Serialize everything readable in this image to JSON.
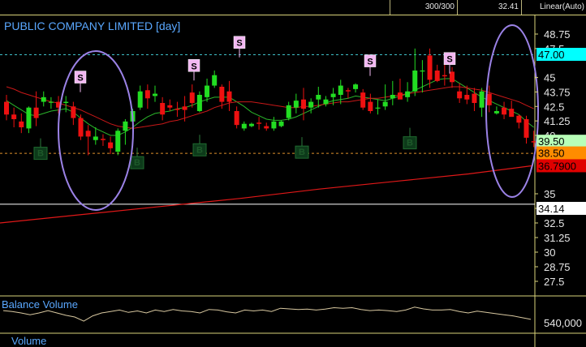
{
  "header": {
    "bars_label": "300/300",
    "last_value": "32.41",
    "scale_mode": "Linear(Auto)"
  },
  "chart_data": [
    {
      "type": "candlestick",
      "title": "PUBLIC COMPANY LIMITED [day]",
      "ylim": [
        26.8,
        50.0
      ],
      "y_ticks": [
        {
          "value": 48.75,
          "label": "48.75"
        },
        {
          "value": 47.5,
          "label": "47.5"
        },
        {
          "value": 45,
          "label": "45"
        },
        {
          "value": 43.75,
          "label": "43.75"
        },
        {
          "value": 42.5,
          "label": "42.5"
        },
        {
          "value": 41.25,
          "label": "41.25"
        },
        {
          "value": 40,
          "label": "40"
        },
        {
          "value": 35,
          "label": "35"
        },
        {
          "value": 33.75,
          "label": "33.75"
        },
        {
          "value": 32.5,
          "label": "32.5"
        },
        {
          "value": 31.25,
          "label": "31.25"
        },
        {
          "value": 30,
          "label": "30"
        },
        {
          "value": 28.75,
          "label": "28.75"
        },
        {
          "value": 27.5,
          "label": "27.5"
        }
      ],
      "price_tags": [
        {
          "label": "47.00",
          "value": 47.0,
          "bg": "#00ffff",
          "fg": "#000000"
        },
        {
          "label": "39.50",
          "value": 39.5,
          "bg": "#b8ffb8",
          "fg": "#000000"
        },
        {
          "label": "38.50",
          "value": 38.5,
          "bg": "#ff8c00",
          "fg": "#000000"
        },
        {
          "label": "36.7900",
          "value": 37.4,
          "bg": "#e00000",
          "fg": "#000000"
        },
        {
          "label": "34.14",
          "value": 33.75,
          "bg": "#ffffff",
          "fg": "#000000"
        }
      ],
      "h_lines": [
        {
          "value": 47.0,
          "style": "dashed",
          "color": "#3fc0c8"
        },
        {
          "value": 38.5,
          "style": "dashed",
          "color": "#e0902a"
        },
        {
          "value": 34.14,
          "style": "solid",
          "color": "#ffffff"
        }
      ],
      "candles": [
        [
          42.9,
          43.5,
          41.3,
          41.8
        ],
        [
          41.8,
          42.4,
          40.7,
          41.4
        ],
        [
          41.2,
          41.9,
          40.2,
          40.7
        ],
        [
          40.6,
          42.5,
          40.2,
          42.4
        ],
        [
          42.4,
          43.8,
          40.8,
          41.5
        ],
        [
          42.9,
          43.8,
          42.5,
          43.3
        ],
        [
          42.9,
          43.3,
          42.3,
          42.9
        ],
        [
          42.9,
          43.4,
          41.9,
          42.4
        ],
        [
          42.8,
          43.4,
          42.0,
          42.9
        ],
        [
          42.5,
          42.9,
          40.9,
          41.5
        ],
        [
          41.5,
          41.8,
          39.6,
          39.9
        ],
        [
          40.4,
          40.9,
          38.3,
          39.9
        ],
        [
          39.6,
          40.7,
          39.2,
          39.9
        ],
        [
          39.7,
          40.1,
          39.1,
          39.6
        ],
        [
          39.4,
          39.9,
          38.4,
          38.9
        ],
        [
          38.6,
          40.6,
          38.3,
          40.4
        ],
        [
          40.4,
          41.4,
          39.2,
          41.2
        ],
        [
          41.2,
          42.3,
          40.4,
          42.1
        ],
        [
          42.4,
          44.3,
          42.2,
          43.8
        ],
        [
          43.9,
          44.4,
          42.3,
          43.2
        ],
        [
          43.4,
          44.3,
          42.9,
          43.6
        ],
        [
          42.8,
          43.3,
          41.3,
          41.8
        ],
        [
          42.6,
          43.1,
          42.1,
          42.4
        ],
        [
          42.3,
          42.9,
          41.6,
          42.2
        ],
        [
          42.5,
          43.4,
          41.2,
          42.2
        ],
        [
          43.7,
          44.4,
          42.4,
          42.8
        ],
        [
          42.1,
          43.8,
          42.0,
          43.5
        ],
        [
          43.3,
          44.9,
          42.9,
          44.3
        ],
        [
          44.3,
          45.6,
          44.1,
          45.2
        ],
        [
          44.2,
          44.4,
          42.3,
          42.9
        ],
        [
          43.8,
          44.7,
          42.1,
          42.9
        ],
        [
          42.1,
          42.5,
          40.6,
          40.9
        ],
        [
          40.6,
          41.2,
          40.4,
          41.0
        ],
        [
          40.8,
          41.1,
          40.7,
          41.0
        ],
        [
          41.1,
          41.6,
          40.5,
          41.0
        ],
        [
          40.8,
          41.1,
          40.4,
          40.6
        ],
        [
          40.6,
          41.6,
          40.4,
          41.2
        ],
        [
          40.8,
          41.3,
          40.7,
          41.2
        ],
        [
          41.5,
          42.9,
          41.3,
          42.6
        ],
        [
          42.4,
          43.6,
          41.9,
          43.0
        ],
        [
          43.1,
          44.1,
          41.3,
          42.3
        ],
        [
          42.4,
          43.2,
          41.9,
          42.9
        ],
        [
          43.1,
          44.2,
          42.4,
          43.5
        ],
        [
          42.7,
          43.4,
          42.5,
          43.1
        ],
        [
          43.3,
          44.1,
          42.6,
          43.6
        ],
        [
          43.5,
          44.8,
          42.7,
          44.3
        ],
        [
          43.9,
          44.1,
          43.2,
          43.8
        ],
        [
          44.0,
          44.5,
          43.7,
          44.4
        ],
        [
          43.7,
          44.0,
          42.2,
          42.4
        ],
        [
          42.9,
          43.6,
          41.9,
          42.1
        ],
        [
          42.4,
          43.1,
          41.8,
          42.4
        ],
        [
          42.5,
          44.4,
          42.2,
          42.9
        ],
        [
          43.2,
          44.7,
          42.6,
          43.5
        ],
        [
          43.7,
          44.9,
          43.2,
          43.1
        ],
        [
          43.3,
          44.6,
          42.9,
          43.8
        ],
        [
          43.8,
          47.5,
          43.4,
          45.6
        ],
        [
          45.6,
          46.5,
          43.7,
          45.6
        ],
        [
          46.9,
          47.5,
          44.1,
          44.8
        ],
        [
          45.6,
          46.1,
          44.6,
          44.7
        ],
        [
          45.2,
          46.1,
          44.3,
          45.1
        ],
        [
          45.5,
          45.9,
          44.1,
          44.6
        ],
        [
          43.8,
          44.5,
          42.8,
          43.2
        ],
        [
          43.5,
          44.3,
          42.7,
          43.1
        ],
        [
          43.6,
          44.1,
          42.1,
          42.8
        ],
        [
          42.4,
          44.1,
          41.6,
          43.8
        ],
        [
          43.6,
          44.3,
          42.0,
          42.6
        ],
        [
          41.9,
          42.5,
          41.8,
          42.1
        ],
        [
          42.4,
          42.9,
          41.4,
          41.8
        ],
        [
          42.3,
          43.0,
          41.7,
          41.6
        ],
        [
          41.7,
          41.8,
          40.6,
          41.1
        ],
        [
          41.4,
          41.7,
          39.3,
          39.8
        ],
        [
          39.5,
          40.4,
          39.0,
          39.4
        ]
      ],
      "series": [
        {
          "name": "",
          "style": "ma-short",
          "color": "#2bb52b",
          "values": [
            43.0,
            42.6,
            42.2,
            41.8,
            41.7,
            41.9,
            42.1,
            42.2,
            42.3,
            42.0,
            41.5,
            41.0,
            40.6,
            40.3,
            40.0,
            40.0,
            40.3,
            40.7,
            41.2,
            41.6,
            41.9,
            42.0,
            42.1,
            42.3,
            42.4,
            42.6,
            42.9,
            43.1,
            43.3,
            43.3,
            43.3,
            42.9,
            42.5,
            42.0,
            41.7,
            41.4,
            41.3,
            41.3,
            41.4,
            41.6,
            41.9,
            42.2,
            42.5,
            42.8,
            43.0,
            43.1,
            43.2,
            43.4,
            43.3,
            43.2,
            43.1,
            43.0,
            43.2,
            43.4,
            43.6,
            43.9,
            44.2,
            44.5,
            44.8,
            44.9,
            44.9,
            44.5,
            44.1,
            43.7,
            43.3,
            43.0,
            42.7,
            42.4,
            42.1,
            41.8,
            41.2,
            40.7
          ]
        },
        {
          "name": "",
          "style": "ma-mid",
          "color": "#c81818",
          "values": [
            44.2,
            44.0,
            43.7,
            43.5,
            43.3,
            43.1,
            42.9,
            42.8,
            42.6,
            42.4,
            42.2,
            41.9,
            41.6,
            41.3,
            41.0,
            40.8,
            40.7,
            40.6,
            40.7,
            40.8,
            40.9,
            41.0,
            41.2,
            41.3,
            41.5,
            41.7,
            41.9,
            42.1,
            42.4,
            42.6,
            42.8,
            42.9,
            42.9,
            42.9,
            42.8,
            42.7,
            42.6,
            42.5,
            42.4,
            42.4,
            42.5,
            42.5,
            42.6,
            42.7,
            42.8,
            42.9,
            42.9,
            43.0,
            43.1,
            43.2,
            43.2,
            43.3,
            43.4,
            43.5,
            43.6,
            43.7,
            43.8,
            43.9,
            44.0,
            44.1,
            44.2,
            44.2,
            44.1,
            44.0,
            43.9,
            43.7,
            43.5,
            43.3,
            43.1,
            42.9,
            42.6,
            42.3
          ]
        },
        {
          "name": "",
          "style": "ma-long",
          "color": "#e01818",
          "points": [
            [
              0,
              32.5
            ],
            [
              0.15,
              33.2
            ],
            [
              0.3,
              33.9
            ],
            [
              0.45,
              34.6
            ],
            [
              0.6,
              35.4
            ],
            [
              0.75,
              36.1
            ],
            [
              0.88,
              36.7
            ],
            [
              1.0,
              37.4
            ]
          ]
        }
      ],
      "signals": [
        {
          "type": "S",
          "index": 13,
          "value": 45.0
        },
        {
          "type": "S",
          "index": 33,
          "value": 46.0
        },
        {
          "type": "S",
          "index": 41,
          "value": 48.0
        },
        {
          "type": "S",
          "index": 64,
          "value": 46.4
        },
        {
          "type": "S",
          "index": 78,
          "value": 46.6
        },
        {
          "type": "B",
          "index": 6,
          "value": 38.5
        },
        {
          "type": "B",
          "index": 23,
          "value": 37.7
        },
        {
          "type": "B",
          "index": 34,
          "value": 38.8
        },
        {
          "type": "B",
          "index": 52,
          "value": 38.6
        },
        {
          "type": "B",
          "index": 71,
          "value": 39.4
        }
      ],
      "highlights": [
        {
          "shape": "ellipse",
          "from_index": 10,
          "to_index": 24
        },
        {
          "shape": "ellipse",
          "from_index": 86,
          "to_index": 94
        }
      ]
    },
    {
      "type": "line",
      "title": "Balance Volume",
      "y_ticks": [
        {
          "value": 540000,
          "label": "540,000"
        }
      ],
      "series": [
        {
          "name": "",
          "color": "#d8c8a0",
          "values": [
            0.58,
            0.55,
            0.5,
            0.44,
            0.5,
            0.58,
            0.5,
            0.42,
            0.36,
            0.22,
            0.4,
            0.5,
            0.55,
            0.6,
            0.52,
            0.57,
            0.5,
            0.6,
            0.55,
            0.62,
            0.57,
            0.55,
            0.5,
            0.62,
            0.6,
            0.54,
            0.5,
            0.6,
            0.57,
            0.6,
            0.55,
            0.66,
            0.64,
            0.62,
            0.63,
            0.6,
            0.63,
            0.68,
            0.66,
            0.68,
            0.62,
            0.58,
            0.6,
            0.58,
            0.55,
            0.6,
            0.7,
            0.64,
            0.6,
            0.6,
            0.62,
            0.55,
            0.5,
            0.56,
            0.52,
            0.48,
            0.44,
            0.4,
            0.34,
            0.28
          ]
        }
      ]
    },
    {
      "type": "bar",
      "title": "Volume"
    }
  ]
}
